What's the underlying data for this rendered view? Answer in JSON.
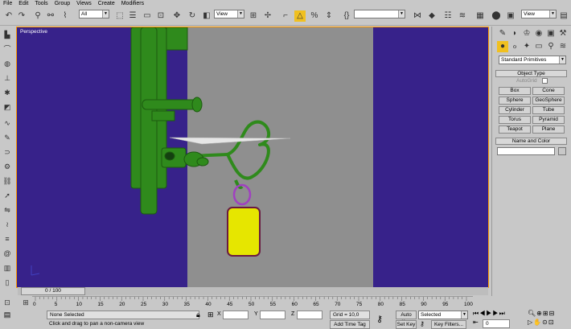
{
  "menu": [
    "File",
    "Edit",
    "Tools",
    "Group",
    "Views",
    "Create",
    "Modifiers"
  ],
  "toolbar": {
    "selection_filter": "All",
    "ref_coord": "View",
    "named_sel": "",
    "right_view": "View"
  },
  "viewport": {
    "label": "Perspective"
  },
  "timeline": {
    "frame_display": "0 / 100",
    "ticks": [
      "0",
      "5",
      "10",
      "15",
      "20",
      "25",
      "30",
      "35",
      "40",
      "45",
      "50",
      "55",
      "60",
      "65",
      "70",
      "75",
      "80",
      "85",
      "90",
      "95",
      "100"
    ]
  },
  "status": {
    "selection": "None Selected",
    "prompt": "Click and drag to pan a non-camera view",
    "x_label": "X",
    "y_label": "Y",
    "z_label": "Z",
    "grid": "Grid = 10,0",
    "add_time_tag": "Add Time Tag",
    "auto_key": "Auto Key",
    "auto_key_mode": "Selected",
    "set_key": "Set Key",
    "key_filters": "Key Filters...",
    "frame": "0"
  },
  "command_panel": {
    "category": "Standard Primitives",
    "object_type_title": "Object Type",
    "autogrid": "AutoGrid",
    "primitives": [
      "Box",
      "Cone",
      "Sphere",
      "GeoSphere",
      "Cylinder",
      "Tube",
      "Torus",
      "Pyramid",
      "Teapot",
      "Plane"
    ],
    "name_color_title": "Name and Color"
  },
  "colors": {
    "viewport_bg": "#37228a",
    "wall": "#8f8f8f",
    "object_green": "#2f8a1c",
    "keychain_yellow": "#e6e600",
    "ring_purple": "#a040c0"
  }
}
